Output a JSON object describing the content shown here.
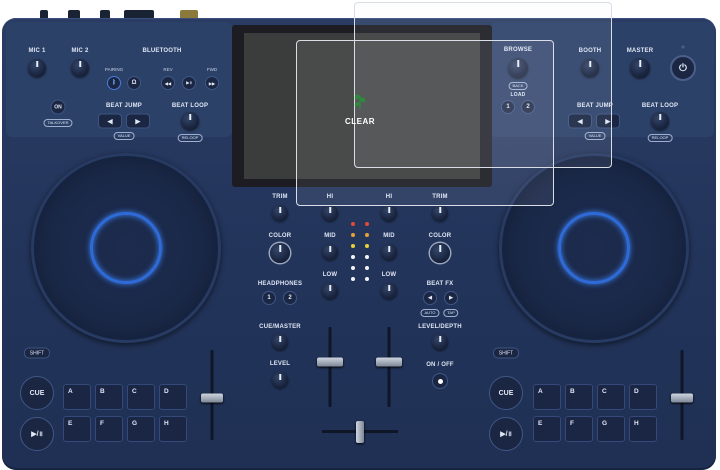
{
  "product_overlay": {
    "brand_label": "CLEAR",
    "brand_color": "#2e8b3e"
  },
  "left_top": {
    "mic1": "MIC 1",
    "mic2": "MIC 2",
    "bluetooth": "BLUETOOTH",
    "bt_pairing": "PAIRING",
    "bt_rev": "REV",
    "bt_fwd": "FWD",
    "on_button": "ON",
    "talkover": "TALKOVER",
    "beat_jump": "BEAT JUMP",
    "value": "VALUE",
    "beat_loop": "BEAT LOOP",
    "reloop": "RELOOP"
  },
  "browse": {
    "title": "BROWSE",
    "back": "BACK",
    "load": "LOAD",
    "load1": "1",
    "load2": "2"
  },
  "right_top": {
    "booth": "BOOTH",
    "master": "MASTER",
    "beat_jump": "BEAT JUMP",
    "value": "VALUE",
    "beat_loop": "BEAT LOOP",
    "reloop": "RELOOP"
  },
  "mixer": {
    "trim_left": "TRIM",
    "hi_left": "HI",
    "hi_right": "HI",
    "trim_right": "TRIM",
    "color_left": "COLOR",
    "mid_left": "MID",
    "mid_right": "MID",
    "color_right": "COLOR",
    "low_left": "LOW",
    "low_right": "LOW",
    "headphones": "HEADPHONES",
    "hp1": "1",
    "hp2": "2",
    "beat_fx": "BEAT FX",
    "auto": "AUTO",
    "tap": "TAP",
    "cue_master": "CUE/MASTER",
    "level": "LEVEL",
    "level_depth": "LEVEL/DEPTH",
    "on_off": "ON / OFF"
  },
  "deck_left": {
    "shift": "SHIFT",
    "cue": "CUE",
    "pads": [
      "A",
      "B",
      "C",
      "D",
      "E",
      "F",
      "G",
      "H"
    ]
  },
  "deck_right": {
    "shift": "SHIFT",
    "cue": "CUE",
    "pads": [
      "A",
      "B",
      "C",
      "D",
      "E",
      "F",
      "G",
      "H"
    ]
  },
  "colors": {
    "body": "#23355b",
    "jog_ring": "#2f6bd8"
  }
}
